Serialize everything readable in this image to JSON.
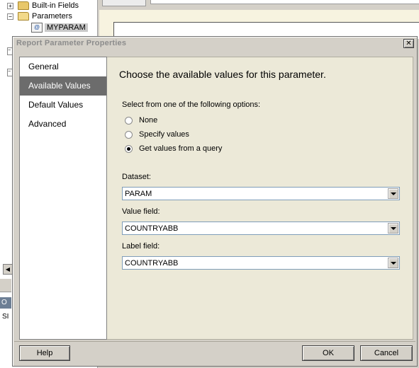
{
  "background": {
    "tree": {
      "items": [
        {
          "label": "Built-in Fields",
          "expander": "+"
        },
        {
          "label": "Parameters",
          "expander": "−"
        },
        {
          "label": "MYPARAM"
        }
      ],
      "side_expanders": [
        "−",
        "−"
      ]
    },
    "left_strip": {
      "label_1": "O",
      "label_2": "SI"
    }
  },
  "dialog": {
    "title": "Report Parameter Properties",
    "close_glyph": "✕",
    "nav": {
      "items": [
        {
          "label": "General",
          "active": false
        },
        {
          "label": "Available Values",
          "active": true
        },
        {
          "label": "Default Values",
          "active": false
        },
        {
          "label": "Advanced",
          "active": false
        }
      ]
    },
    "content": {
      "heading": "Choose the available values for this parameter.",
      "options_label": "Select from one of the following options:",
      "options": [
        {
          "label": "None",
          "checked": false
        },
        {
          "label": "Specify values",
          "checked": false
        },
        {
          "label": "Get values from a query",
          "checked": true
        }
      ],
      "dataset": {
        "label": "Dataset:",
        "value": "PARAM"
      },
      "value_field": {
        "label": "Value field:",
        "value": "COUNTRYABB"
      },
      "label_field": {
        "label": "Label field:",
        "value": "COUNTRYABB"
      }
    },
    "buttons": {
      "help": "Help",
      "ok": "OK",
      "cancel": "Cancel"
    }
  }
}
